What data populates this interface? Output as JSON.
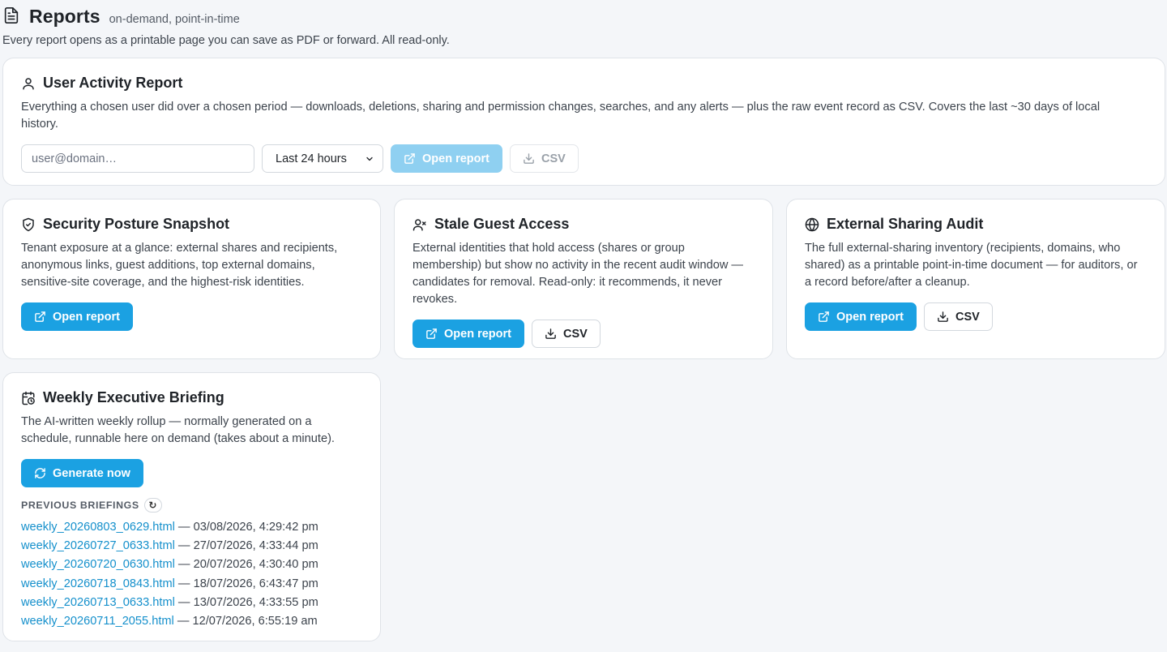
{
  "header": {
    "title": "Reports",
    "subtitle": "on-demand, point-in-time",
    "description": "Every report opens as a printable page you can save as PDF or forward. All read-only."
  },
  "user_activity": {
    "title": "User Activity Report",
    "description": "Everything a chosen user did over a chosen period — downloads, deletions, sharing and permission changes, searches, and any alerts — plus the raw event record as CSV. Covers the last ~30 days of local history.",
    "user_placeholder": "user@domain…",
    "user_value": "",
    "period_selected": "Last 24 hours",
    "open_label": "Open report",
    "csv_label": "CSV"
  },
  "security_posture": {
    "title": "Security Posture Snapshot",
    "description": "Tenant exposure at a glance: external shares and recipients, anonymous links, guest additions, top external domains, sensitive-site coverage, and the highest-risk identities.",
    "open_label": "Open report"
  },
  "stale_guest": {
    "title": "Stale Guest Access",
    "description": "External identities that hold access (shares or group membership) but show no activity in the recent audit window — candidates for removal. Read-only: it recommends, it never revokes.",
    "open_label": "Open report",
    "csv_label": "CSV"
  },
  "external_sharing": {
    "title": "External Sharing Audit",
    "description": "The full external-sharing inventory (recipients, domains, who shared) as a printable point-in-time document — for auditors, or a record before/after a cleanup.",
    "open_label": "Open report",
    "csv_label": "CSV"
  },
  "weekly_briefing": {
    "title": "Weekly Executive Briefing",
    "description": "The AI-written weekly rollup — normally generated on a schedule, runnable here on demand (takes about a minute).",
    "generate_label": "Generate now",
    "previous_label": "PREVIOUS BRIEFINGS",
    "refresh_glyph": "↻",
    "briefings": [
      {
        "file": "weekly_20260803_0629.html",
        "time": " — 03/08/2026, 4:29:42 pm"
      },
      {
        "file": "weekly_20260727_0633.html",
        "time": " — 27/07/2026, 4:33:44 pm"
      },
      {
        "file": "weekly_20260720_0630.html",
        "time": " — 20/07/2026, 4:30:40 pm"
      },
      {
        "file": "weekly_20260718_0843.html",
        "time": " — 18/07/2026, 6:43:47 pm"
      },
      {
        "file": "weekly_20260713_0633.html",
        "time": " — 13/07/2026, 4:33:55 pm"
      },
      {
        "file": "weekly_20260711_2055.html",
        "time": " — 12/07/2026, 6:55:19 am"
      }
    ]
  },
  "icons": {
    "header": "document-icon",
    "user_activity": "user-icon",
    "security_posture": "shield-icon",
    "stale_guest": "user-x-icon",
    "external_sharing": "globe-icon",
    "weekly_briefing": "calendar-clock-icon"
  },
  "colors": {
    "accent": "#1ba1e2",
    "accent_disabled": "#8fd0f1",
    "link": "#1590cc",
    "background": "#f4f6f9"
  }
}
